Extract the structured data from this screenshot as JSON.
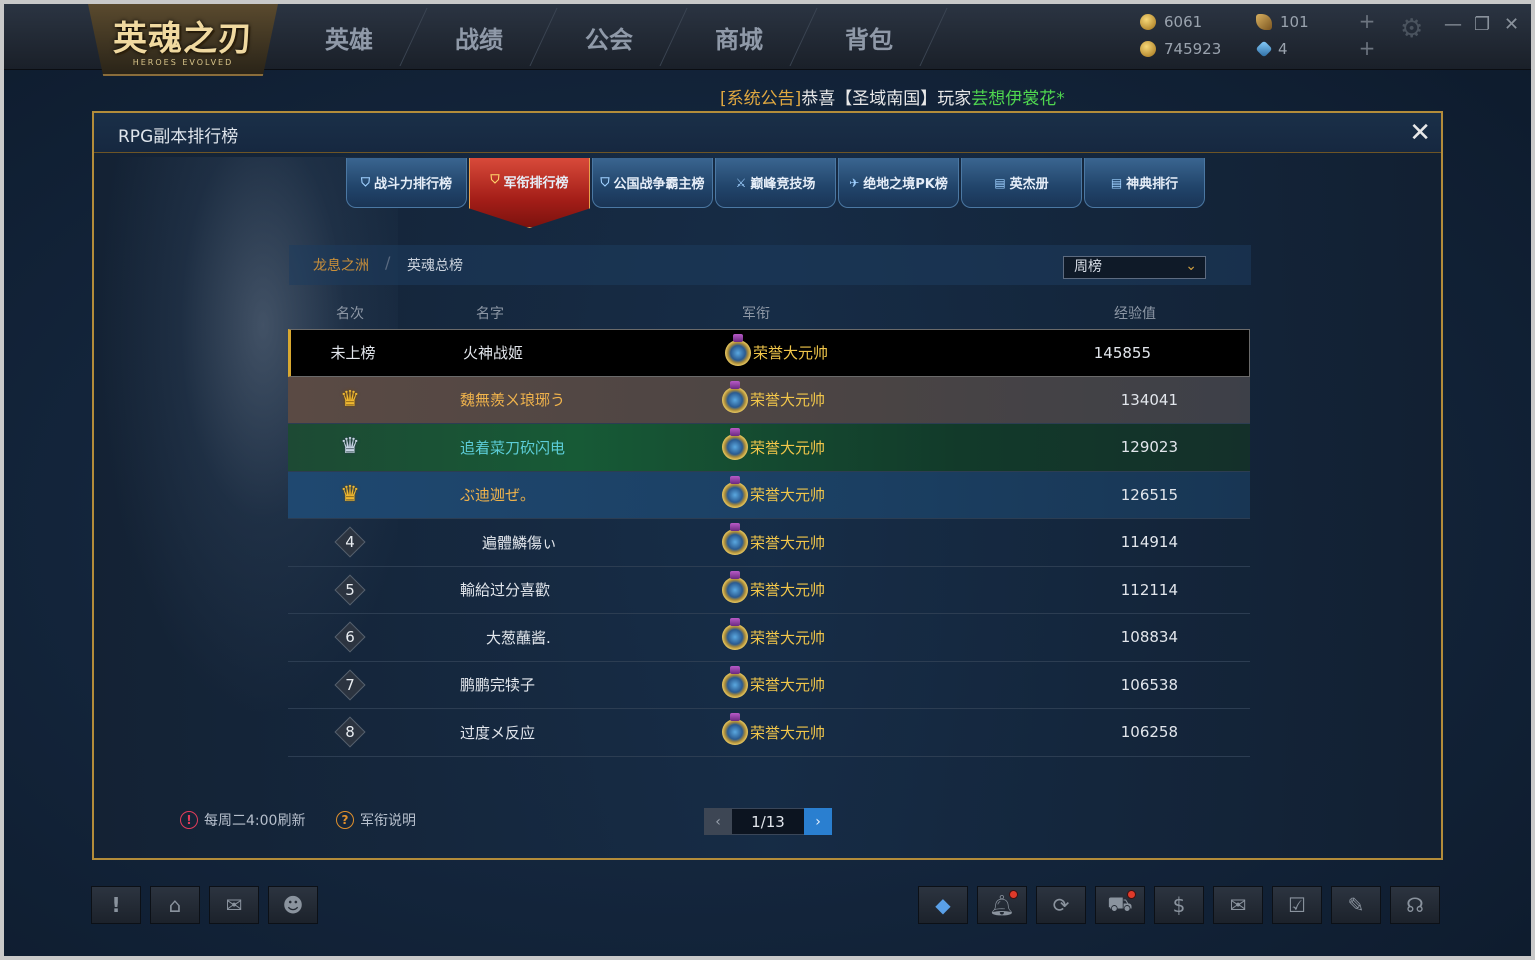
{
  "app": {
    "logo_main": "英魂之刃",
    "logo_sub": "HEROES EVOLVED"
  },
  "nav": {
    "items": [
      {
        "label": "英雄"
      },
      {
        "label": "战绩"
      },
      {
        "label": "公会"
      },
      {
        "label": "商城"
      },
      {
        "label": "背包"
      }
    ]
  },
  "currencies": {
    "gold": "6061",
    "silver": "745923",
    "leaf": "101",
    "gem": "4"
  },
  "announcement": {
    "tag": "[系统公告]",
    "text": "恭喜【圣域南国】玩家",
    "player": "芸想伊裳花*"
  },
  "dialog": {
    "title": "RPG副本排行榜",
    "tabs": [
      {
        "label": "战斗力排行榜",
        "icon": "shield-icon",
        "active": false
      },
      {
        "label": "军衔排行榜",
        "icon": "shield-icon",
        "active": true
      },
      {
        "label": "公国战争霸主榜",
        "icon": "shield-icon",
        "active": false
      },
      {
        "label": "巅峰竞技场",
        "icon": "crossed-swords-icon",
        "active": false
      },
      {
        "label": "绝地之境PK榜",
        "icon": "plane-icon",
        "active": false
      },
      {
        "label": "英杰册",
        "icon": "book-icon",
        "active": false
      },
      {
        "label": "神典排行",
        "icon": "book-icon",
        "active": false
      }
    ],
    "breadcrumb": {
      "level1": "龙息之洲",
      "separator": "/",
      "level2": "英魂总榜"
    },
    "period_select": {
      "selected": "周榜"
    },
    "columns": {
      "rank": "名次",
      "name": "名字",
      "title": "军衔",
      "exp": "经验值"
    },
    "my_row": {
      "rank": "未上榜",
      "name": "火神战姬",
      "title": "荣誉大元帅",
      "exp": "145855"
    },
    "rows": [
      {
        "rank": "1",
        "name": "魏無羨ㄨ琅琊う",
        "title": "荣誉大元帅",
        "exp": "134041"
      },
      {
        "rank": "2",
        "name": "追着菜刀砍闪电",
        "title": "荣誉大元帅",
        "exp": "129023"
      },
      {
        "rank": "3",
        "name": "ぶ迪迦ぜ。",
        "title": "荣誉大元帅",
        "exp": "126515"
      },
      {
        "rank": "4",
        "name": "遍體鱗傷ぃ",
        "title": "荣誉大元帅",
        "exp": "114914"
      },
      {
        "rank": "5",
        "name": "輸給过分喜歡",
        "title": "荣誉大元帅",
        "exp": "112114"
      },
      {
        "rank": "6",
        "name": "大葱蘸酱.",
        "title": "荣誉大元帅",
        "exp": "108834"
      },
      {
        "rank": "7",
        "name": "鹏鹏完犊子",
        "title": "荣誉大元帅",
        "exp": "106538"
      },
      {
        "rank": "8",
        "name": "过度メ反应",
        "title": "荣誉大元帅",
        "exp": "106258"
      }
    ],
    "footer": {
      "refresh_note": "每周二4:00刷新",
      "help_link": "军衔说明",
      "page": "1/13"
    }
  },
  "colors": {
    "accent_gold": "#b38c3a",
    "title_gold": "#f1c64a",
    "active_tab_red": "#a41e18",
    "rank2_green": "#175a36",
    "rank3_blue": "#1b3f62"
  }
}
